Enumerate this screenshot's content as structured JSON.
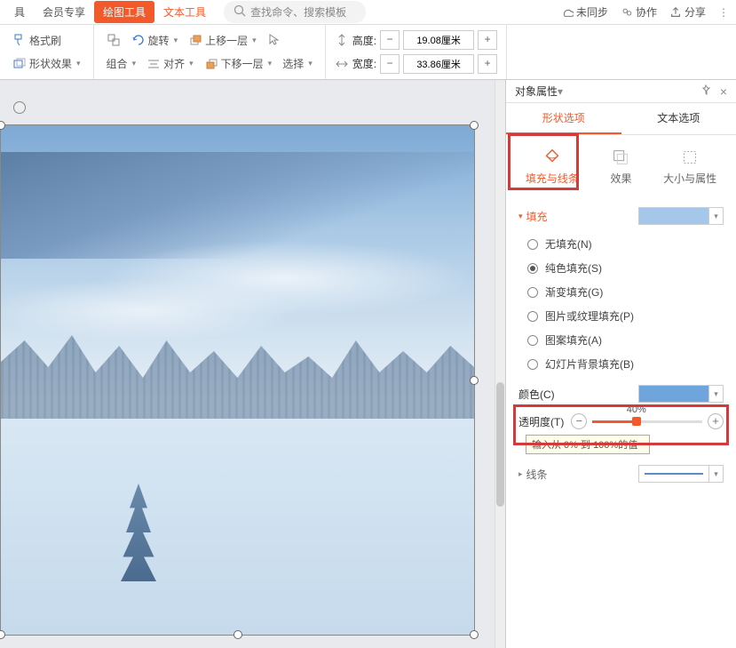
{
  "menu": {
    "tools": "具",
    "member": "会员专享",
    "draw_tools": "绘图工具",
    "text_tools": "文本工具",
    "search_ph": "查找命令、搜索模板"
  },
  "top_right": {
    "unsync": "未同步",
    "collab": "协作",
    "share": "分享"
  },
  "toolbar": {
    "format_painter": "格式刷",
    "shape_effect": "形状效果",
    "group": "组合",
    "rotate": "旋转",
    "align": "对齐",
    "bring_forward": "上移一层",
    "send_backward": "下移一层",
    "select": "选择",
    "height_label": "高度:",
    "width_label": "宽度:",
    "height_val": "19.08厘米",
    "width_val": "33.86厘米"
  },
  "panel": {
    "title": "对象属性",
    "tab_shape": "形状选项",
    "tab_text": "文本选项",
    "mode_fill": "填充与线条",
    "mode_effect": "效果",
    "mode_size": "大小与属性",
    "fill_section": "填充",
    "fill_options": {
      "none": "无填充(N)",
      "solid": "纯色填充(S)",
      "gradient": "渐变填充(G)",
      "picture": "图片或纹理填充(P)",
      "pattern": "图案填充(A)",
      "slidebg": "幻灯片背景填充(B)"
    },
    "color_label": "颜色(C)",
    "opacity_label": "透明度(T)",
    "opacity_value": "40%",
    "range_hint": "输入从 0% 到 100%的值",
    "line_section": "线条"
  }
}
